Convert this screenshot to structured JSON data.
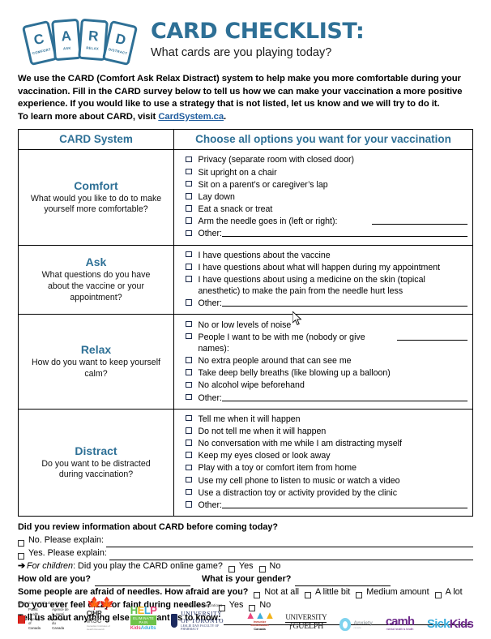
{
  "header": {
    "logo": {
      "cards": [
        {
          "letter": "C",
          "sub": "COMFORT"
        },
        {
          "letter": "A",
          "sub": "ASK"
        },
        {
          "letter": "R",
          "sub": "RELAX"
        },
        {
          "letter": "D",
          "sub": "DISTRACT"
        }
      ],
      "accent_color": "#2E7096"
    },
    "title": "CARD CHECKLIST:",
    "subtitle": "What cards are you playing today?"
  },
  "intro": {
    "line1": "We use the CARD (Comfort Ask Relax Distract) system to help make you more comfortable during your",
    "line2": "vaccination. Fill in the CARD survey below to tell us how we can make your vaccination a more positive",
    "line3": "experience. If you would like to use a strategy that is not listed, let us know and we will try to do it.",
    "line4_prefix": "To learn more about CARD, visit ",
    "link": "CardSystem.ca",
    "line4_suffix": "."
  },
  "table": {
    "headers": {
      "left": "CARD System",
      "right": "Choose all options you want for your vaccination"
    },
    "sections": [
      {
        "name": "Comfort",
        "question": "What would you like to do to make yourself more comfortable?",
        "options": [
          {
            "text": "Privacy (separate room with closed door)",
            "rule": ""
          },
          {
            "text": "Sit upright on a chair",
            "rule": ""
          },
          {
            "text": "Sit on a parent’s or caregiver’s lap",
            "rule": ""
          },
          {
            "text": "Lay down",
            "rule": ""
          },
          {
            "text": "Eat a snack or treat",
            "rule": ""
          },
          {
            "text": "Arm the needle goes in (left or right):",
            "rule": "md"
          },
          {
            "text": "Other:",
            "rule": "xl"
          }
        ]
      },
      {
        "name": "Ask",
        "question": "What questions do you have about the vaccine or your appointment?",
        "options": [
          {
            "text": "I have questions about the vaccine",
            "rule": ""
          },
          {
            "text": "I have questions about what will happen during my appointment",
            "rule": ""
          },
          {
            "text": "I have questions about using a medicine on the skin (topical anesthetic) to make the pain from the needle hurt less",
            "rule": ""
          },
          {
            "text": "Other:",
            "rule": "xl"
          }
        ]
      },
      {
        "name": "Relax",
        "question": "How do you want to keep yourself calm?",
        "options": [
          {
            "text": "No or low levels of noise",
            "rule": ""
          },
          {
            "text": "People I want to be with me (nobody or give names):",
            "rule": "sm"
          },
          {
            "text": "No extra people around that can see me",
            "rule": ""
          },
          {
            "text": "Take deep belly breaths (like blowing up a balloon)",
            "rule": ""
          },
          {
            "text": "No alcohol wipe beforehand",
            "rule": ""
          },
          {
            "text": "Other:",
            "rule": "xl"
          }
        ]
      },
      {
        "name": "Distract",
        "question": "Do you want to be distracted during vaccination?",
        "options": [
          {
            "text": "Tell me when it will happen",
            "rule": ""
          },
          {
            "text": "Do not tell me when it will happen",
            "rule": ""
          },
          {
            "text": "No conversation with me while I am distracting myself",
            "rule": ""
          },
          {
            "text": "Keep my eyes closed or look away",
            "rule": ""
          },
          {
            "text": "Play with a toy or comfort item from home",
            "rule": ""
          },
          {
            "text": "Use my cell phone to listen to music or watch a video",
            "rule": ""
          },
          {
            "text": "Use a distraction toy or activity provided by the clinic",
            "rule": ""
          },
          {
            "text": "Other:",
            "rule": "xl"
          }
        ]
      }
    ]
  },
  "bottom": {
    "review_question": "Did you review information about CARD before coming today?",
    "review_no": "No. Please explain:",
    "review_yes": "Yes. Please explain:",
    "children_arrow": "➔",
    "children_italic": "For children",
    "children_rest": ": Did you play the CARD online game?",
    "children_yes": "Yes",
    "children_no": "No",
    "age_question": "How old are you?",
    "gender_question": "What is your gender?",
    "fear_question": "Some people are afraid of needles. How afraid are you?",
    "fear_options": [
      "Not at all",
      "A little bit",
      "Medium amount",
      "A lot"
    ],
    "dizzy_question": "Do you ever feel dizzy or faint during needles?",
    "dizzy_yes": "Yes",
    "dizzy_no": "No",
    "anything_else": "Tell us about anything else you want us to know:"
  },
  "footer": {
    "financial_caption": "Financial contribution from",
    "partner_caption": "Partner Organizations",
    "gov_en": "Public Health\nAgency of Canada",
    "gov_fr": "Agence de la santé\npublique du Canada",
    "cihr": "CIHR",
    "cihr_alt": "IRSC",
    "cihr_sub": "Canadian Institutes of Health Research",
    "help_letters": "HELP",
    "help_bar": "ELIMINATE PAIN",
    "help_kids": "Kids",
    "help_adults": "Adults",
    "uoft_line1": "UNIVERSITY OF TORONTO",
    "uoft_line2": "LESLIE DAN FACULTY OF PHARMACY",
    "iic_line1": "Immunize",
    "iic_line2": "Immunisation",
    "iic_line3": "Canada",
    "guelph_line1": "UNIVERSITY",
    "guelph_line2": "ƒGUELPH",
    "anxiety_name": "Anxiety",
    "anxiety_sub": "canada",
    "camh_name": "camh",
    "camh_sub": "mental health is health",
    "sickkids_a": "Sick",
    "sickkids_b": "Kids"
  }
}
